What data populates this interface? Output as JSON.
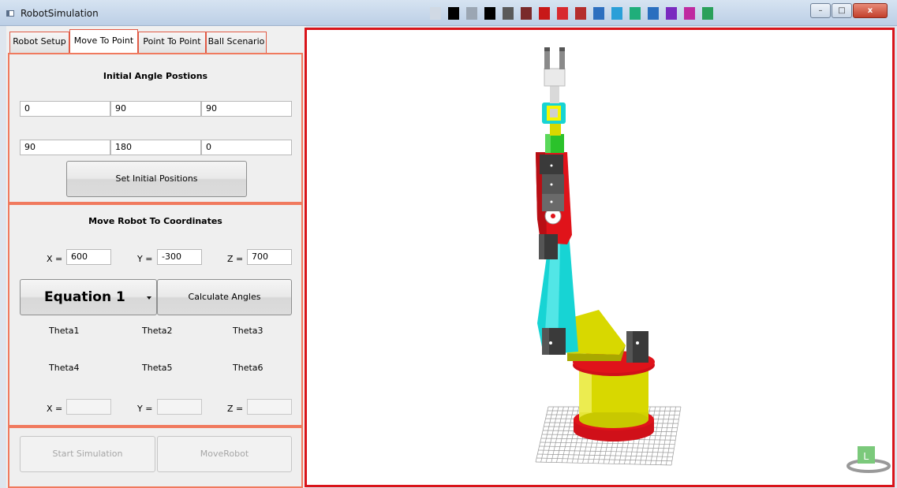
{
  "window": {
    "title": "RobotSimulation",
    "controls": {
      "minimize": "–",
      "maximize": "□",
      "close": "x"
    }
  },
  "toolbar_palette": [
    "#d0d9e4",
    "#000000",
    "#9ba6b3",
    "#000000",
    "#5a5a5a",
    "#7a2a2a",
    "#c81818",
    "#d8292f",
    "#b42d2d",
    "#2d6fbf",
    "#2a9fd8",
    "#1fae7a",
    "#2a6fbf",
    "#7a2abf",
    "#bf2aa0",
    "#2aa05a"
  ],
  "tabs": [
    {
      "label": "Robot Setup",
      "active": false
    },
    {
      "label": "Move To Point",
      "active": true
    },
    {
      "label": "Point To Point",
      "active": false
    },
    {
      "label": "Ball Scenario",
      "active": false
    }
  ],
  "initial_angles": {
    "title": "Initial Angle Postions",
    "values": [
      "0",
      "90",
      "90",
      "90",
      "180",
      "0"
    ],
    "set_button": "Set Initial Positions"
  },
  "move_to": {
    "title": "Move Robot To Coordinates",
    "x_label": "X =",
    "x_value": "600",
    "y_label": "Y =",
    "y_value": "-300",
    "z_label": "Z =",
    "z_value": "700",
    "equation_selected": "Equation 1",
    "calculate_button": "Calculate Angles",
    "thetas": [
      "Theta1",
      "Theta2",
      "Theta3",
      "Theta4",
      "Theta5",
      "Theta6"
    ],
    "result_x_label": "X =",
    "result_y_label": "Y =",
    "result_z_label": "Z ="
  },
  "actions": {
    "start_button": "Start Simulation",
    "move_button": "MoveRobot"
  },
  "viewcube": {
    "label": "L"
  },
  "colors": {
    "panel_border": "#f07a5e",
    "viewport_border": "#d9141a",
    "robot_red": "#e0131a",
    "robot_yellow": "#d8d800",
    "robot_cyan": "#17d4d4",
    "robot_green": "#2bc22b",
    "motor_gray": "#3a3a3a"
  }
}
